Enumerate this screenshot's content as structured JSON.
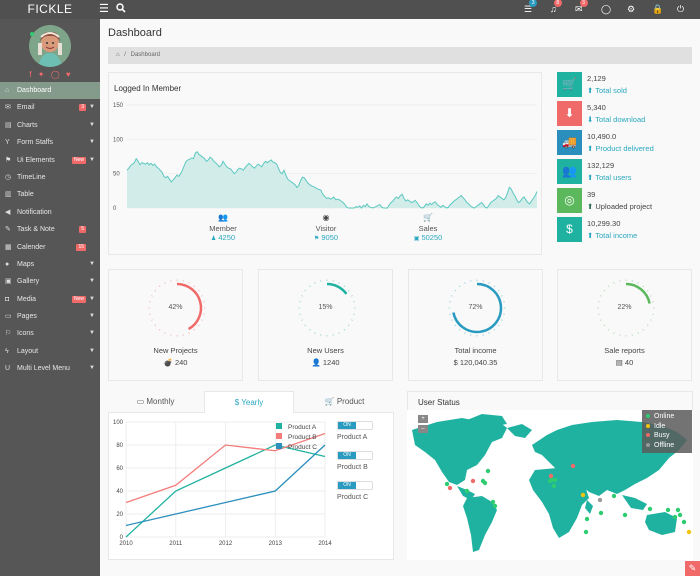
{
  "app": {
    "brand": "FICKLE"
  },
  "topbar": {
    "icons": [
      {
        "name": "tasks-icon",
        "glyph": "☰",
        "badge": "3",
        "badge_color": "#2a9bc0"
      },
      {
        "name": "bell-icon",
        "glyph": "♫",
        "badge": "8",
        "badge_color": "#f06a6a"
      },
      {
        "name": "mail-icon",
        "glyph": "✉",
        "badge": "3",
        "badge_color": "#f06a6a"
      },
      {
        "name": "chat-icon",
        "glyph": "◯",
        "badge": null
      },
      {
        "name": "cogs-icon",
        "glyph": "⚙",
        "badge": null
      },
      {
        "name": "lock-icon",
        "glyph": "🔒",
        "badge": null
      },
      {
        "name": "power-icon",
        "glyph": "⏻",
        "badge": null
      }
    ]
  },
  "sidebar": {
    "social": [
      "f",
      "t",
      "g",
      "p"
    ],
    "items": [
      {
        "label": "Dashboard",
        "icon": "⌂",
        "active": true,
        "badge": null,
        "arrow": false
      },
      {
        "label": "Email",
        "icon": "✉",
        "active": false,
        "badge": "3",
        "arrow": true
      },
      {
        "label": "Charts",
        "icon": "▤",
        "active": false,
        "badge": null,
        "arrow": true
      },
      {
        "label": "Form Staffs",
        "icon": "Y",
        "active": false,
        "badge": null,
        "arrow": true
      },
      {
        "label": "Ui Elements",
        "icon": "⚑",
        "active": false,
        "badge": "New",
        "arrow": true
      },
      {
        "label": "TimeLine",
        "icon": "◷",
        "active": false,
        "badge": null,
        "arrow": false
      },
      {
        "label": "Table",
        "icon": "▥",
        "active": false,
        "badge": null,
        "arrow": false
      },
      {
        "label": "Notification",
        "icon": "◀",
        "active": false,
        "badge": null,
        "arrow": false
      },
      {
        "label": "Task & Note",
        "icon": "✎",
        "active": false,
        "badge": "5",
        "arrow": false
      },
      {
        "label": "Calender",
        "icon": "▦",
        "active": false,
        "badge": "15",
        "arrow": false
      },
      {
        "label": "Maps",
        "icon": "●",
        "active": false,
        "badge": null,
        "arrow": true
      },
      {
        "label": "Gallery",
        "icon": "▣",
        "active": false,
        "badge": null,
        "arrow": true
      },
      {
        "label": "Media",
        "icon": "◘",
        "active": false,
        "badge": "New",
        "arrow": true
      },
      {
        "label": "Pages",
        "icon": "▭",
        "active": false,
        "badge": null,
        "arrow": true
      },
      {
        "label": "Icons",
        "icon": "⚐",
        "active": false,
        "badge": null,
        "arrow": true
      },
      {
        "label": "Layout",
        "icon": "ϟ",
        "active": false,
        "badge": null,
        "arrow": true
      },
      {
        "label": "Multi Level Menu",
        "icon": "U",
        "active": false,
        "badge": null,
        "arrow": true
      }
    ]
  },
  "page": {
    "title": "Dashboard",
    "breadcrumb_home": "⌂",
    "breadcrumb_sep": "/",
    "breadcrumb_current": "Dashboard"
  },
  "logged_in": {
    "title": "Logged In Member",
    "stats": [
      {
        "label": "Member",
        "value": "4250",
        "icon": "users-icon",
        "small_icon": "user-icon"
      },
      {
        "label": "Visitor",
        "value": "9050",
        "icon": "eye-icon",
        "small_icon": "flag-icon"
      },
      {
        "label": "Sales",
        "value": "50250",
        "icon": "cart-icon",
        "small_icon": "money-icon"
      }
    ]
  },
  "stats": [
    {
      "value": "2,129",
      "label": "Total sold",
      "direction": "up",
      "color": "#20b2a0",
      "icon": "🛒"
    },
    {
      "value": "5,340",
      "label": "Total download",
      "direction": "down",
      "color": "#f06a6a",
      "icon": "⬇"
    },
    {
      "value": "10,490.0",
      "label": "Product delivered",
      "direction": "up",
      "color": "#2a8fbd",
      "icon": "🚚"
    },
    {
      "value": "132,129",
      "label": "Total users",
      "direction": "up",
      "color": "#20b2a0",
      "icon": "👥"
    },
    {
      "value": "39",
      "label": "Uploaded project",
      "direction": "up",
      "color": "#5cb85c",
      "icon": "◎"
    },
    {
      "value": "10,299.30",
      "label": "Total income",
      "direction": "up",
      "color": "#20b2a0",
      "icon": "$"
    }
  ],
  "gauges": [
    {
      "percent": 42,
      "label": "New Projects",
      "value": "240",
      "icon": "💣",
      "color": "#f06a6a"
    },
    {
      "percent": 15,
      "label": "New Users",
      "value": "1240",
      "icon": "👤",
      "color": "#20b2a0"
    },
    {
      "percent": 72,
      "label": "Total income",
      "value": "120,040.35",
      "icon": "$",
      "color": "#2a9bc0"
    },
    {
      "percent": 22,
      "label": "Sale reports",
      "value": "40",
      "icon": "▤",
      "color": "#5cb85c"
    }
  ],
  "tabs": [
    {
      "label": "Monthly",
      "icon": "▭",
      "active": false
    },
    {
      "label": "Yearly",
      "icon": "$",
      "active": true
    },
    {
      "label": "Product",
      "icon": "🛒",
      "active": false
    }
  ],
  "toggles": [
    {
      "state": "ON",
      "label": "Product A"
    },
    {
      "state": "ON",
      "label": "Product B"
    },
    {
      "state": "ON",
      "label": "Product C"
    }
  ],
  "user_status": {
    "title": "User Status",
    "zoom_in": "+",
    "zoom_out": "–",
    "legend": [
      {
        "label": "Online",
        "color": "#2ecc71"
      },
      {
        "label": "Idle",
        "color": "#f1c40f"
      },
      {
        "label": "Busy",
        "color": "#f06a6a"
      },
      {
        "label": "Offline",
        "color": "#999999"
      }
    ]
  },
  "chart_data": [
    {
      "type": "area",
      "title": "Logged In Member",
      "ylim": [
        0,
        150
      ],
      "yticks": [
        "0",
        "50",
        "100",
        "150"
      ],
      "grid": true,
      "color": "#5cc8c0",
      "values": [
        55,
        58,
        62,
        64,
        66,
        72,
        68,
        63,
        66,
        65,
        64,
        66,
        63,
        65,
        62,
        64,
        60,
        58,
        55,
        52,
        46,
        44,
        46,
        42,
        38,
        41,
        44,
        48,
        46,
        50,
        55,
        62,
        68,
        70,
        71,
        73,
        72,
        80,
        82,
        78,
        76,
        74,
        72,
        68,
        70,
        74,
        72,
        68,
        66,
        63,
        60,
        62,
        68,
        64,
        60,
        58,
        57,
        54,
        50,
        52,
        56,
        58,
        57,
        55,
        59,
        62,
        65,
        63,
        60,
        58,
        61,
        64,
        62,
        60,
        65,
        68,
        66,
        68,
        70,
        67,
        66,
        64,
        58,
        52,
        50,
        55,
        48,
        42,
        40,
        38,
        36,
        34,
        30,
        33,
        40,
        45,
        44,
        40,
        36,
        34,
        32,
        31,
        30,
        28,
        27,
        26,
        20,
        17,
        14,
        15,
        13,
        14,
        16,
        12,
        13,
        12,
        10,
        8,
        5,
        1,
        0,
        0,
        0,
        0,
        2,
        1,
        3,
        0,
        4,
        2,
        6,
        2,
        1,
        0,
        1,
        2,
        4,
        5,
        1,
        0,
        0,
        0,
        5,
        8,
        10,
        14,
        16,
        14,
        18,
        20,
        14,
        10,
        12,
        10,
        8,
        9,
        11,
        8,
        4,
        1,
        0,
        2,
        6,
        4,
        7,
        5,
        8,
        9,
        5,
        3,
        1,
        4,
        2,
        0,
        1,
        5,
        7,
        10,
        12,
        14,
        16,
        18,
        15,
        12,
        8,
        6,
        3,
        1,
        0,
        2,
        4,
        6,
        8,
        5,
        1,
        0,
        4,
        8,
        10,
        12,
        14,
        18,
        16,
        14,
        12,
        15,
        22,
        30,
        28,
        22,
        18,
        12,
        8,
        10,
        14,
        16,
        12,
        8,
        6,
        10,
        14,
        18,
        24
      ]
    },
    {
      "type": "line",
      "categories": [
        "2010",
        "2011",
        "2012",
        "2013",
        "2014"
      ],
      "ylim": [
        0,
        100
      ],
      "yticks": [
        "0",
        "20",
        "40",
        "60",
        "80",
        "100"
      ],
      "grid": true,
      "legend": "top-right",
      "series": [
        {
          "name": "Product A",
          "color": "#20b2a0",
          "values": [
            0,
            40,
            60,
            80,
            70
          ]
        },
        {
          "name": "Product B",
          "color": "#f47c7c",
          "values": [
            30,
            45,
            80,
            75,
            90
          ]
        },
        {
          "name": "Product C",
          "color": "#2a8fbd",
          "values": [
            10,
            20,
            30,
            40,
            80
          ]
        }
      ]
    }
  ]
}
